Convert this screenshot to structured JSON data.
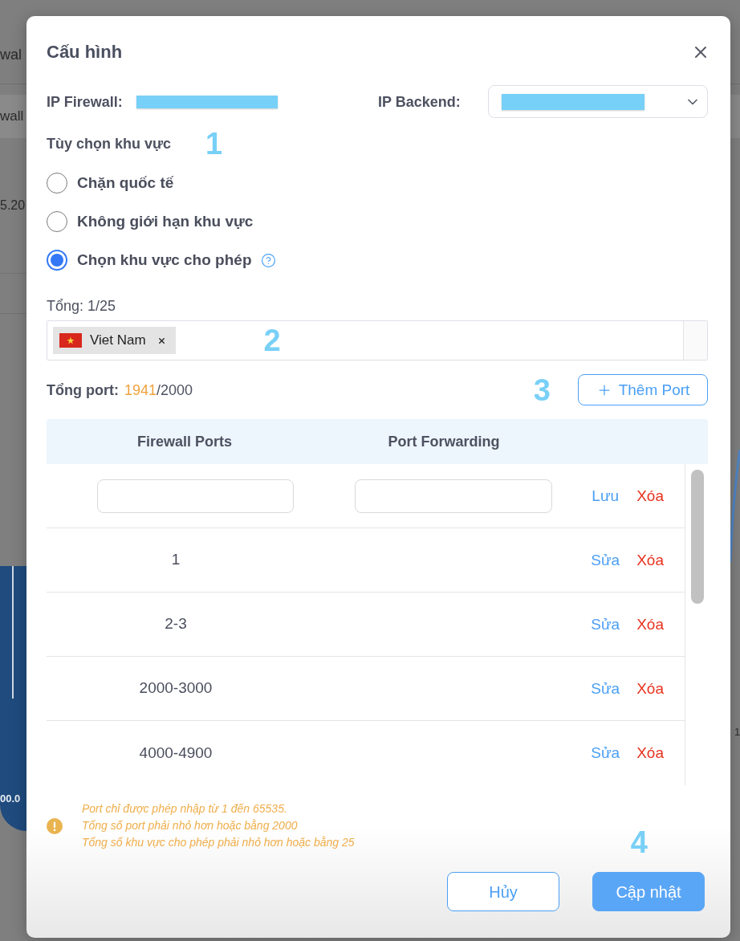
{
  "background_page": {
    "header_text": "wal",
    "row_text": "wall",
    "value_text": "5.20",
    "chart_label": "00.0",
    "axis_label": "1"
  },
  "dialog": {
    "title": "Cấu hình",
    "ip_firewall": {
      "label": "IP Firewall:"
    },
    "ip_backend": {
      "label": "IP Backend:"
    },
    "region_options": {
      "title": "Tùy chọn khu vực",
      "marker": "1",
      "options": [
        {
          "label": "Chặn quốc tế",
          "selected": false,
          "help": false
        },
        {
          "label": "Không giới hạn khu vực",
          "selected": false,
          "help": false
        },
        {
          "label": "Chọn khu vực cho phép",
          "selected": true,
          "help": true
        }
      ]
    },
    "regions_field": {
      "count": "Tổng: 1/25",
      "marker": "2",
      "tags": [
        {
          "label": "Viet Nam"
        }
      ]
    },
    "port_total": {
      "label": "Tổng port:",
      "used": "1941",
      "limit": "/2000",
      "marker": "3"
    },
    "add_port_button": {
      "label": "Thêm Port"
    },
    "table": {
      "columns": [
        "Firewall Ports",
        "Port Forwarding"
      ],
      "new_row": {
        "save": "Lưu",
        "delete": "Xóa"
      },
      "rows": [
        {
          "firewall_port": "1",
          "edit": "Sửa",
          "delete": "Xóa"
        },
        {
          "firewall_port": "2-3",
          "edit": "Sửa",
          "delete": "Xóa"
        },
        {
          "firewall_port": "2000-3000",
          "edit": "Sửa",
          "delete": "Xóa"
        },
        {
          "firewall_port": "4000-4900",
          "edit": "Sửa",
          "delete": "Xóa"
        }
      ]
    },
    "notes": [
      "Port chỉ được phép nhập từ 1 đến 65535.",
      "Tổng số port phải nhỏ hơn hoặc bằng 2000",
      "Tổng số khu vực cho phép phải nhỏ hơn hoặc bằng 25"
    ],
    "marker": "4",
    "buttons": [
      {
        "label": "Hủy",
        "kind": "secondary"
      },
      {
        "label": "Cập nhật",
        "kind": "primary"
      }
    ]
  }
}
